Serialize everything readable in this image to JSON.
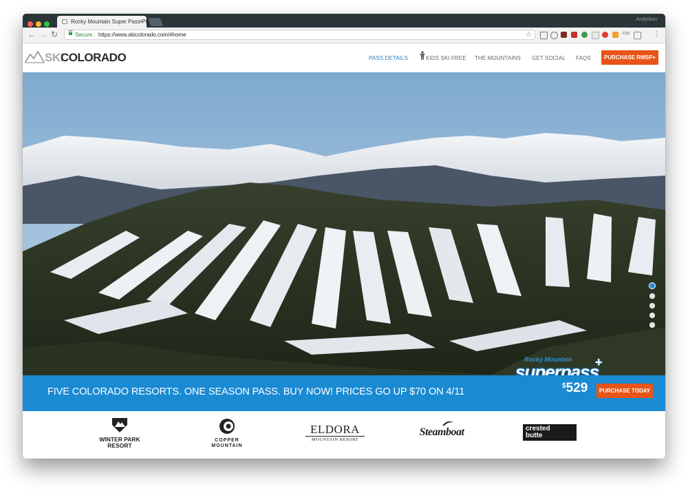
{
  "browser": {
    "tab_title": "Rocky Mountain Super Pass Pl",
    "tab_close": "×",
    "profile_name": "Andy/Ann",
    "secure_label": "Secure",
    "url": "https://www.skicolorado.com/#home",
    "ext_css_label": "css",
    "colors": {
      "close": "#fc5f57",
      "minimize": "#fdbc2e",
      "maximize": "#28c840"
    }
  },
  "site": {
    "logo_ski": "SKI",
    "logo_colorado": "COLORADO",
    "nav": {
      "pass_details": "PASS DETAILS",
      "kids_ski_free": "KIDS SKI FREE",
      "the_mountains": "THE MOUNTAINS",
      "get_social": "GET SOCIAL",
      "faqs": "FAQS"
    },
    "purchase_button": "PURCHASE RMSP+",
    "accent_color": "#e85418",
    "active_nav_color": "#2b7ec0"
  },
  "hero": {
    "superpass_brand_top": "Rocky Mountain",
    "superpass_brand_word": "superpass",
    "superpass_plus": "+",
    "slides_total": 5,
    "slide_active": 1
  },
  "banner": {
    "headline": "FIVE COLORADO RESORTS. ONE SEASON PASS. BUY NOW! PRICES GO UP $70 ON 4/11",
    "price_currency": "$",
    "price_amount": "529",
    "cta": "PURCHASE TODAY",
    "color": "#1a8ad2"
  },
  "resorts": {
    "winter_park": "WINTER PARK\nRESORT",
    "copper": "COPPER\nMOUNTAIN",
    "eldora": "ELDORA",
    "eldora_sub": "MOUNTAIN RESORT",
    "steamboat": "Steamboat",
    "crested_butte": "crested\nbutte",
    "crested_butte_sub": "COLORADO"
  }
}
